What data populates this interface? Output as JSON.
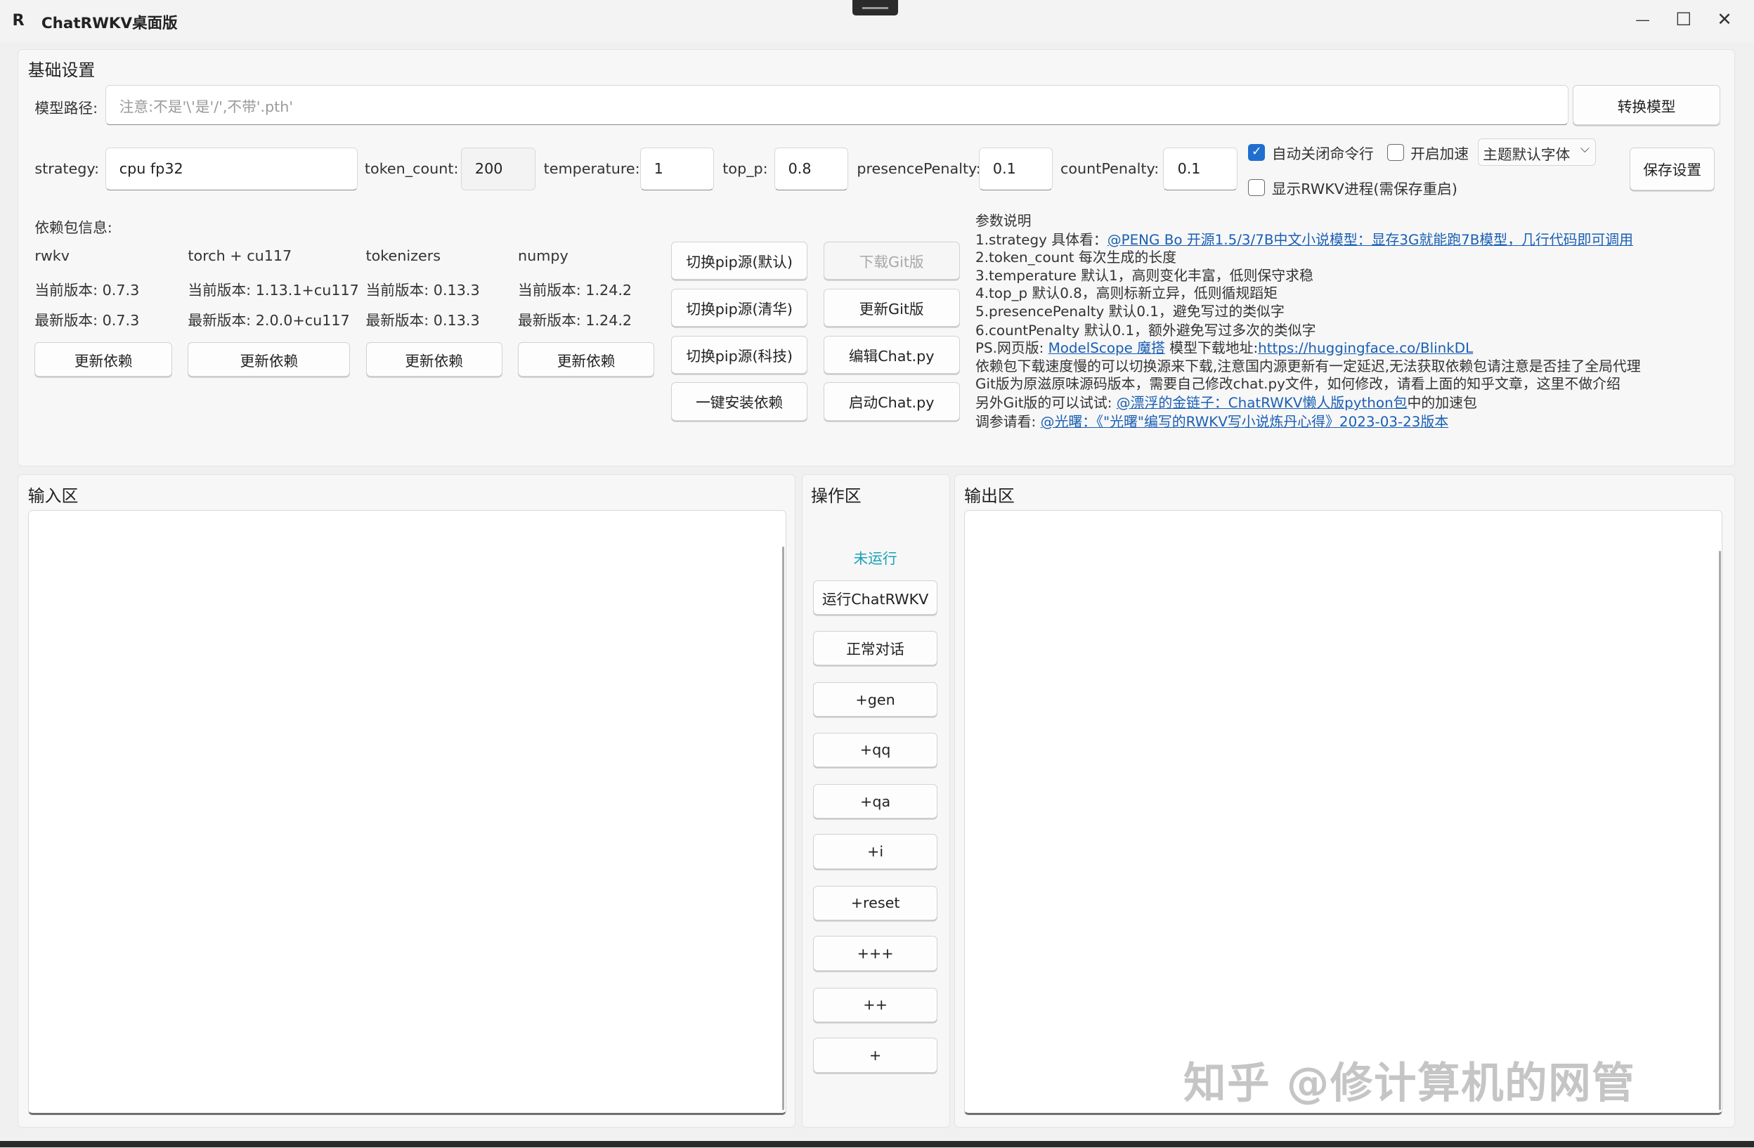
{
  "window": {
    "title": "ChatRWKV桌面版",
    "logo": "R",
    "controls": {
      "minimize": "—",
      "maximize": "☐",
      "close": "✕"
    }
  },
  "basic": {
    "section_title": "基础设置",
    "model_path_label": "模型路径:",
    "model_path_placeholder": "注意:不是'\\'是'/',不带'.pth'",
    "convert_button": "转换模型",
    "strategy_label": "strategy:",
    "strategy_value": "cpu fp32",
    "token_count_label": "token_count:",
    "token_count_value": "200",
    "temperature_label": "temperature:",
    "temperature_value": "1",
    "top_p_label": "top_p:",
    "top_p_value": "0.8",
    "presence_label": "presencePenalty:",
    "presence_value": "0.1",
    "count_label": "countPenalty:",
    "count_value": "0.1",
    "auto_close_label": "自动关闭命令行",
    "auto_close_checked": true,
    "accelerate_label": "开启加速",
    "accelerate_checked": false,
    "font_select": "主题默认字体",
    "show_process_label": "显示RWKV进程(需保存重启)",
    "show_process_checked": false,
    "save_button": "保存设置"
  },
  "deps": {
    "title": "依赖包信息:",
    "packages": [
      {
        "name": "rwkv",
        "current": "当前版本:  0.7.3",
        "latest": "最新版本:  0.7.3",
        "button": "更新依赖"
      },
      {
        "name": "torch + cu117",
        "current": "当前版本:  1.13.1+cu117",
        "latest": "最新版本:  2.0.0+cu117",
        "button": "更新依赖"
      },
      {
        "name": "tokenizers",
        "current": "当前版本:  0.13.3",
        "latest": "最新版本:  0.13.3",
        "button": "更新依赖"
      },
      {
        "name": "numpy",
        "current": "当前版本:  1.24.2",
        "latest": "最新版本:  1.24.2",
        "button": "更新依赖"
      }
    ],
    "pip_buttons": [
      "切换pip源(默认)",
      "切换pip源(清华)",
      "切换pip源(科技)",
      "一键安装依赖"
    ],
    "git_buttons": [
      "下载Git版",
      "更新Git版",
      "编辑Chat.py",
      "启动Chat.py"
    ]
  },
  "params_help": {
    "title": "参数说明",
    "l1_text": "1.strategy 具体看：",
    "l1_link": "@PENG Bo 开源1.5/3/7B中文小说模型：显存3G就能跑7B模型，几行代码即可调用",
    "l2": "2.token_count 每次生成的长度",
    "l3": "3.temperature 默认1，高则变化丰富，低则保守求稳",
    "l4": "4.top_p 默认0.8，高则标新立异，低则循规蹈矩",
    "l5": "5.presencePenalty 默认0.1，避免写过的类似字",
    "l6": "6.countPenalty 默认0.1，额外避免写过多次的类似字",
    "l7_text": "PS.网页版: ",
    "l7_link1": "ModelScope 魔搭",
    "l7_mid": "  模型下载地址:",
    "l7_link2": "https://huggingface.co/BlinkDL",
    "l8": "依赖包下载速度慢的可以切换源来下载,注意国内源更新有一定延迟,无法获取依赖包请注意是否挂了全局代理",
    "l9": "Git版为原滋原味源码版本，需要自己修改chat.py文件，如何修改，请看上面的知乎文章，这里不做介绍",
    "l10_text": "另外Git版的可以试试: ",
    "l10_link": "@漂浮的金链子：ChatRWKV懒人版python包",
    "l10_tail": "中的加速包",
    "l11_text": "调参请看: ",
    "l11_link": "@光曙：《\"光曙\"编写的RWKV写小说炼丹心得》2023-03-23版本"
  },
  "input_area": {
    "title": "输入区"
  },
  "ops_area": {
    "title": "操作区",
    "status": "未运行",
    "status_color": "#17a2b8",
    "buttons": [
      "运行ChatRWKV",
      "正常对话",
      "+gen",
      "+qq",
      "+qa",
      "+i",
      "+reset",
      "+++",
      "++",
      "+"
    ]
  },
  "output_area": {
    "title": "输出区"
  },
  "watermark": "知乎 @修计算机的网管"
}
